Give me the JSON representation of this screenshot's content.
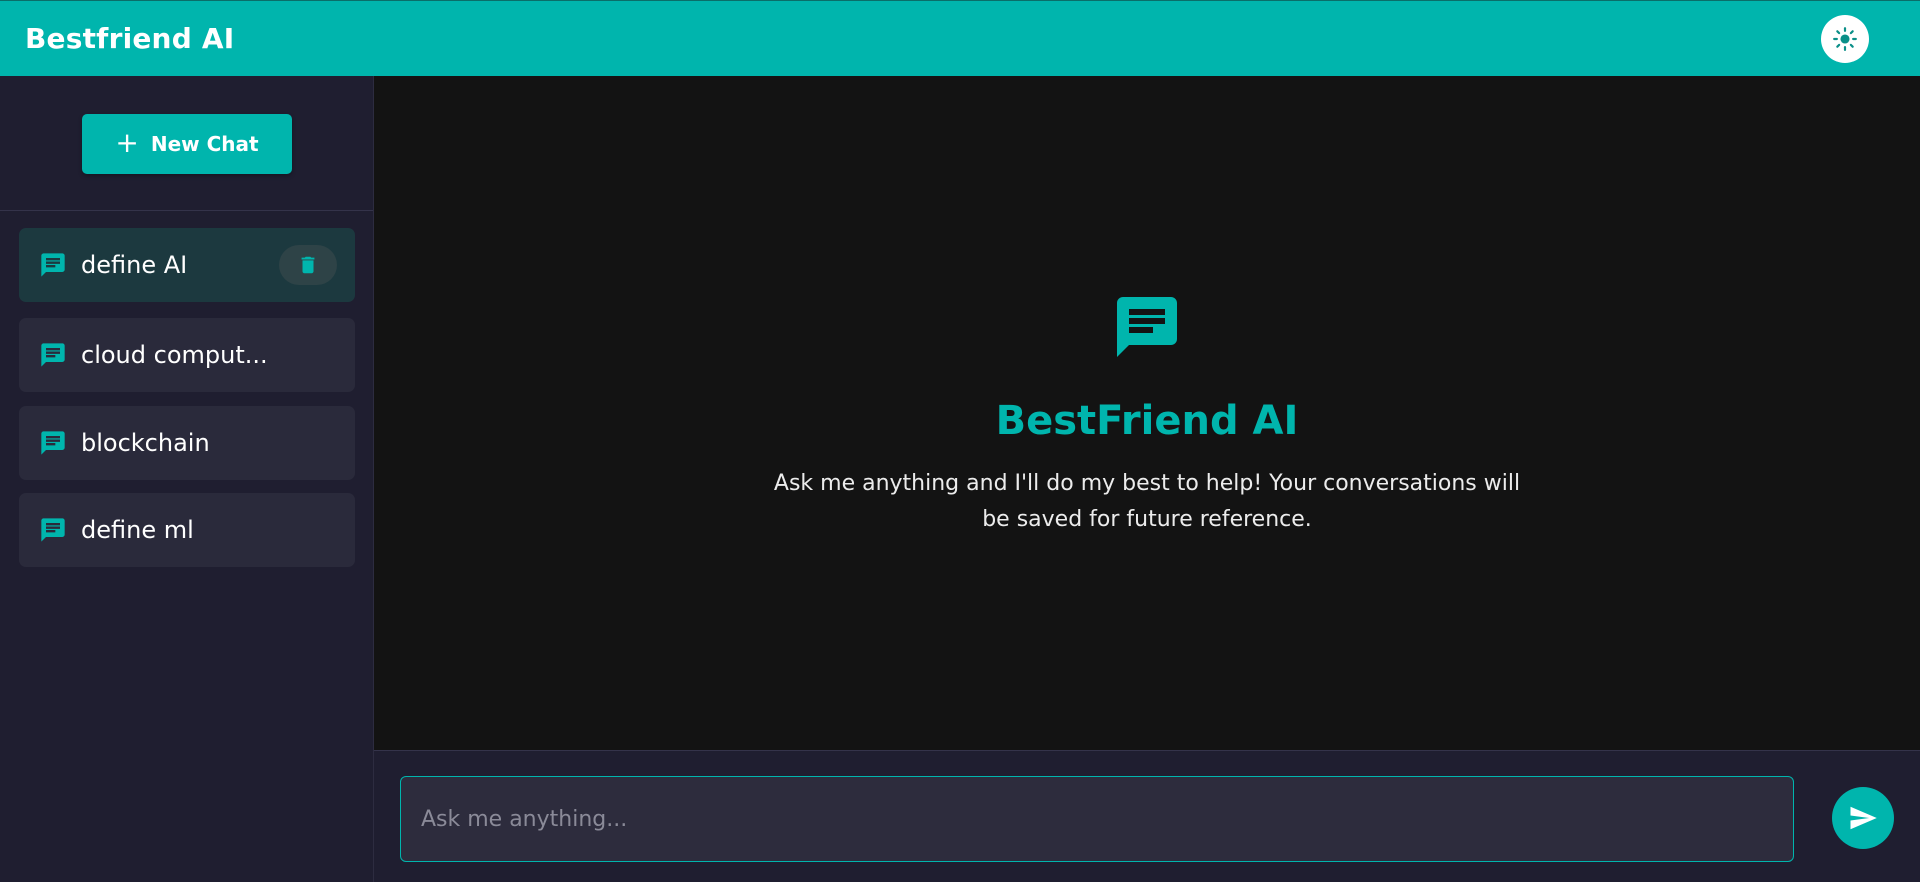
{
  "header": {
    "brand": "Bestfriend AI",
    "theme_toggle_icon": "sun-icon"
  },
  "sidebar": {
    "new_chat_label": "New Chat",
    "chats": [
      {
        "label": "define AI",
        "active": true
      },
      {
        "label": "cloud comput..."
      },
      {
        "label": "blockchain"
      },
      {
        "label": "define ml"
      }
    ]
  },
  "welcome": {
    "icon": "message-icon",
    "title": "BestFriend AI",
    "subtitle": "Ask me anything and I'll do my best to help! Your conversations will be saved for future reference."
  },
  "composer": {
    "placeholder": "Ask me anything...",
    "send_icon": "send-icon"
  },
  "colors": {
    "accent": "#00b5ad",
    "sidebar_bg": "#1f1e30",
    "main_bg": "#131313",
    "chat_item_bg": "#2a2a3b",
    "chat_item_active_bg": "#1c393f"
  }
}
